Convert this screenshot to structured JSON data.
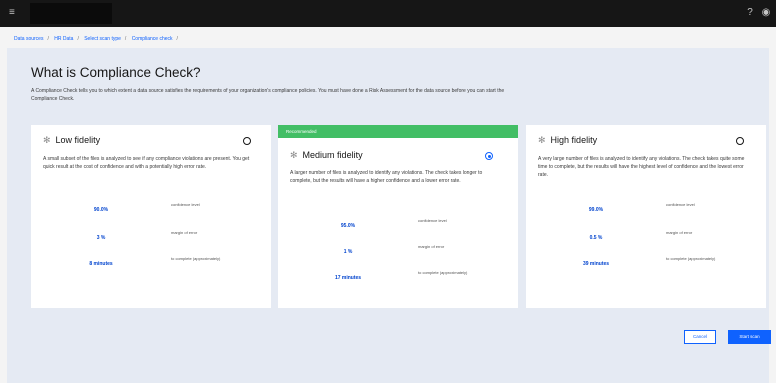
{
  "header": {
    "menu_icon": "≡",
    "help_icon": "?",
    "user_icon": "◉"
  },
  "breadcrumb": [
    "Data sources",
    "HR Data",
    "Select scan type",
    "Compliance check"
  ],
  "page": {
    "title": "What is Compliance Check?",
    "intro": "A Compliance Check tells you to which extent a data source satisfies the requirements of your organization's compliance policies. You must have done a Risk Assessment for the data source before you can start the Compliance Check."
  },
  "options": [
    {
      "title": "Low fidelity",
      "selected": false,
      "recommended": false,
      "description": "A small subset of the files is analyzed to see if any compliance violations are present. You get quick result at the cost of confidence and with a potentially high error rate.",
      "metrics": [
        {
          "value": "90.0%",
          "label": "confidence level"
        },
        {
          "value": "3 %",
          "label": "margin of error"
        },
        {
          "value": "8 minutes",
          "label": "to complete (approximately)"
        }
      ]
    },
    {
      "title": "Medium fidelity",
      "selected": true,
      "recommended": true,
      "recommended_label": "Recommended",
      "description": "A larger number of files is analyzed to identify any violations. The check takes longer to complete, but the results will have a higher confidence and a lower error rate.",
      "metrics": [
        {
          "value": "95.0%",
          "label": "confidence level"
        },
        {
          "value": "1 %",
          "label": "margin of error"
        },
        {
          "value": "17 minutes",
          "label": "to complete (approximately)"
        }
      ]
    },
    {
      "title": "High fidelity",
      "selected": false,
      "recommended": false,
      "description": "A very large number of files is analyzed to identify any violations. The check takes quite some time to complete, but the results will have the highest level of confidence and the lowest error rate.",
      "metrics": [
        {
          "value": "99.0%",
          "label": "confidence level"
        },
        {
          "value": "0.5 %",
          "label": "margin of error"
        },
        {
          "value": "39 minutes",
          "label": "to complete (approximately)"
        }
      ]
    }
  ],
  "buttons": {
    "cancel": "Cancel",
    "start": "Start scan"
  },
  "colors": {
    "topbar": "#161616",
    "accent": "#0f62fe",
    "recommended": "#42be65",
    "background": "#e5eaf3"
  }
}
